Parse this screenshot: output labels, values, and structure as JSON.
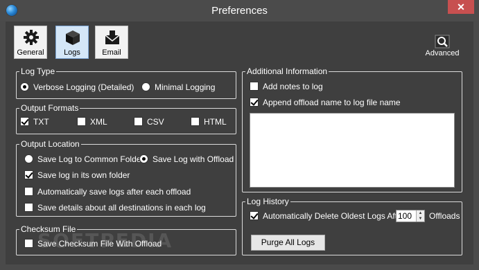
{
  "window": {
    "title": "Preferences",
    "close_glyph": "✕"
  },
  "toolbar": {
    "tabs": [
      {
        "label": "General",
        "icon": "gear-icon"
      },
      {
        "label": "Logs",
        "icon": "cube-icon",
        "selected": true
      },
      {
        "label": "Email",
        "icon": "envelope-icon"
      }
    ],
    "advanced_label": "Advanced"
  },
  "log_type": {
    "legend": "Log Type",
    "options": [
      {
        "label": "Verbose Logging (Detailed)",
        "checked": true
      },
      {
        "label": "Minimal Logging",
        "checked": false
      }
    ]
  },
  "output_formats": {
    "legend": "Output Formats",
    "options": [
      {
        "label": "TXT",
        "checked": true
      },
      {
        "label": "XML",
        "checked": false
      },
      {
        "label": "CSV",
        "checked": false
      },
      {
        "label": "HTML",
        "checked": false
      }
    ]
  },
  "output_location": {
    "legend": "Output Location",
    "radios": [
      {
        "label": "Save Log to Common Folder",
        "checked": false
      },
      {
        "label": "Save Log with Offload",
        "checked": true
      }
    ],
    "checks": [
      {
        "label": "Save log in its own folder",
        "checked": true
      },
      {
        "label": "Automatically save logs after each offload",
        "checked": false
      },
      {
        "label": "Save details about all destinations in each log",
        "checked": false
      }
    ]
  },
  "checksum": {
    "legend": "Checksum File",
    "option": {
      "label": "Save Checksum File With Offload",
      "checked": false
    }
  },
  "additional_info": {
    "legend": "Additional Information",
    "checks": [
      {
        "label": "Add notes to log",
        "checked": false
      },
      {
        "label": "Append offload name to log file name",
        "checked": true
      }
    ],
    "notes_value": ""
  },
  "log_history": {
    "legend": "Log History",
    "auto_delete": {
      "label": "Automatically Delete Oldest Logs After",
      "checked": true
    },
    "count": "100",
    "unit_label": "Offloads",
    "purge_label": "Purge All Logs"
  },
  "watermark": "SOFTPEDIA"
}
